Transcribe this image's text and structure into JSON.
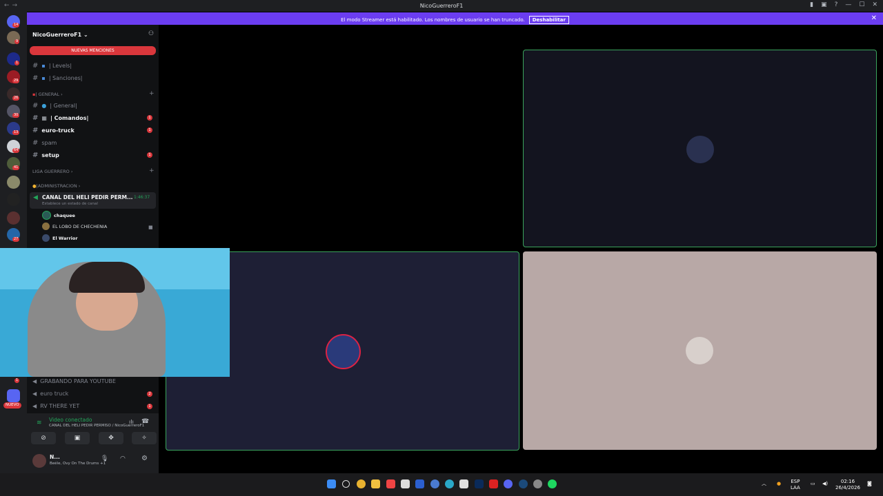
{
  "window": {
    "title": "NicoGuerreroF1"
  },
  "banner": {
    "text": "El modo Streamer está habilitado. Los nombres de usuario se han truncado.",
    "button": "Deshabilitar",
    "close": "✕"
  },
  "guild_badges": [
    "14",
    "9",
    "1",
    "29",
    "26",
    "30",
    "13",
    "64",
    "41",
    "27",
    "1"
  ],
  "guild_new": "NUEVO",
  "server": {
    "name": "NicoGuerreroF1",
    "chevron": "⌄"
  },
  "new_mentions": "NUEVAS MENCIONES",
  "channels_top": [
    {
      "name": "| Levels|",
      "prefix": "▪"
    },
    {
      "name": "| Sanciones|",
      "prefix": "▪"
    }
  ],
  "category_general": "| GENERAL",
  "channels_general": [
    {
      "name": "| General|",
      "bold": false,
      "badge": ""
    },
    {
      "name": "| Comandos|",
      "bold": true,
      "badge": "1"
    },
    {
      "name": "euro-truck",
      "bold": true,
      "badge": "1"
    },
    {
      "name": "spam",
      "bold": false,
      "badge": ""
    },
    {
      "name": "setup",
      "bold": true,
      "badge": "1"
    }
  ],
  "category_liga": "LIGA GUERRERO",
  "category_admin": "|ADMINISTRACION",
  "voice_channel": {
    "name": "CANAL DEL HELI PEDIR PERM...",
    "timer": "1:46:37",
    "status": "Establece un estado de canal"
  },
  "voice_users": [
    "chaquee",
    "EL LOBO DE CHECHENIA",
    "El Warrior"
  ],
  "voice_channels_bottom": [
    {
      "name": "GRABANDO PARA YOUTUBE",
      "badge": ""
    },
    {
      "name": "euro truck",
      "badge": "2"
    },
    {
      "name": "RV THERE YET",
      "badge": "1"
    }
  ],
  "connection": {
    "status": "Video conectado",
    "channel": "CANAL DEL HELI PEDIR PERMISO / NicoGuerreroF1"
  },
  "user": {
    "name": "N...",
    "activity": "Beéle, Ovy On The Drums +1"
  },
  "taskbar": {
    "lang": "ESP",
    "layout": "LAA",
    "time": "02:16",
    "date": "26/4/2026"
  },
  "colors": {
    "accent": "#6b3df1",
    "mention": "#da373c",
    "connected": "#23a55a",
    "speaking": "#3ba55d"
  }
}
